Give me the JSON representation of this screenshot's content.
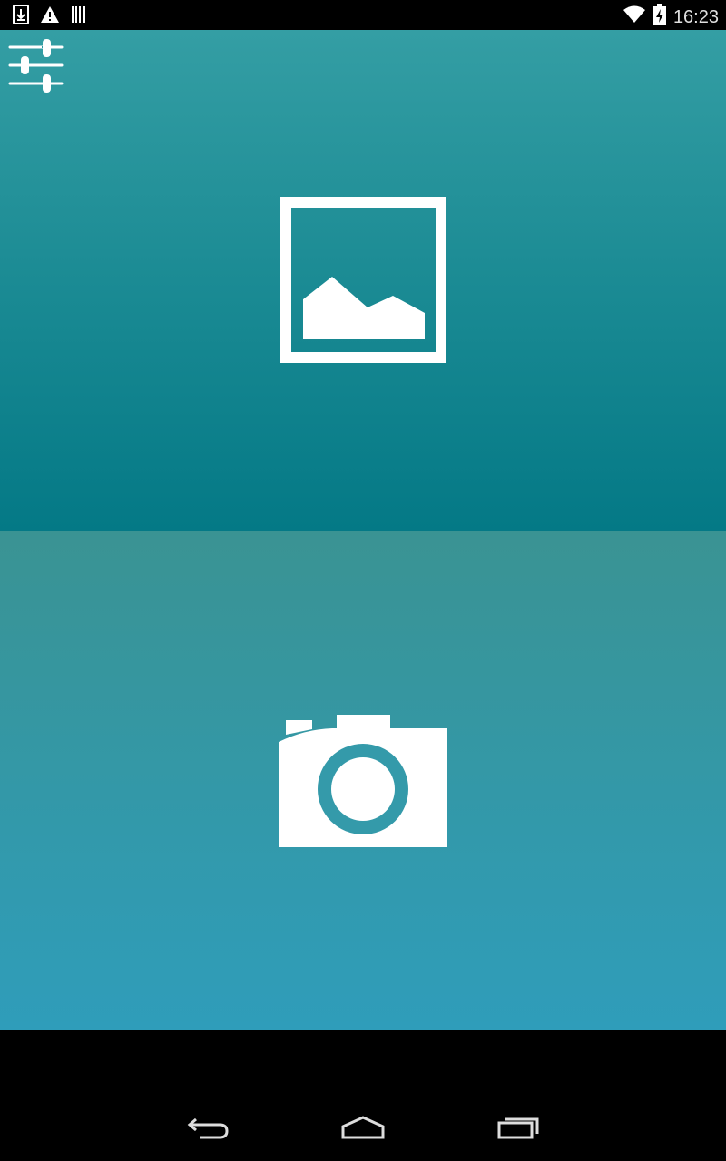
{
  "status_bar": {
    "time": "16:23",
    "left_icons": [
      "download-icon",
      "warning-icon",
      "barcode-icon"
    ],
    "right_icons": [
      "wifi-icon",
      "battery-charging-icon"
    ]
  },
  "toolbar": {
    "settings_icon": "sliders-icon"
  },
  "panels": {
    "gallery": {
      "icon": "image-gallery-icon"
    },
    "camera": {
      "icon": "camera-icon"
    }
  },
  "nav_bar": {
    "buttons": [
      "back-icon",
      "home-icon",
      "recents-icon"
    ]
  },
  "colors": {
    "gallery_top": "#349ea4",
    "gallery_bottom": "#047986",
    "camera_top": "#3a9393",
    "camera_bottom": "#2f9dba",
    "icon": "#ffffff"
  }
}
